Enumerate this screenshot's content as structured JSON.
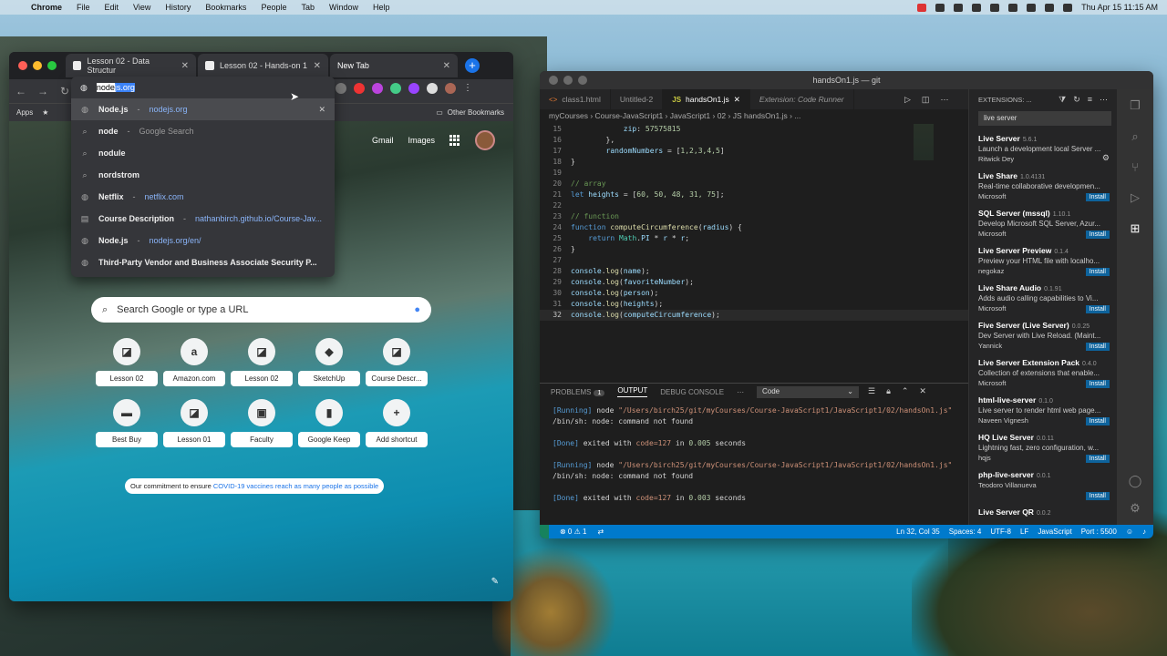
{
  "menubar": {
    "app": "Chrome",
    "items": [
      "File",
      "Edit",
      "View",
      "History",
      "Bookmarks",
      "People",
      "Tab",
      "Window",
      "Help"
    ],
    "clock": "Thu Apr 15  11:15 AM"
  },
  "chrome": {
    "tabs": [
      {
        "label": "Lesson 02 - Data Structur"
      },
      {
        "label": "Lesson 02 - Hands-on 1"
      },
      {
        "label": "New Tab"
      }
    ],
    "bookmarks": {
      "apps": "Apps",
      "other": "Other Bookmarks"
    },
    "omnibox": {
      "typed": "node",
      "autocomplete": "js.org",
      "suggestions": [
        {
          "main": "Node.js",
          "sep": " - ",
          "url": "nodejs.org",
          "icon": "globe-icon"
        },
        {
          "main": "node",
          "sep": " - ",
          "url": "Google Search",
          "icon": "search-icon",
          "gs": true
        },
        {
          "main": "nodule",
          "sep": "",
          "url": "",
          "icon": "search-icon"
        },
        {
          "main": "nordstrom",
          "sep": "",
          "url": "",
          "icon": "search-icon"
        },
        {
          "main": "Netflix",
          "sep": " - ",
          "url": "netflix.com",
          "icon": "globe-icon"
        },
        {
          "main": "Course Description",
          "sep": " - ",
          "url": "nathanbirch.github.io/Course-Jav...",
          "icon": "bookmark-icon"
        },
        {
          "main": "Node.js",
          "sep": " - ",
          "url": "nodejs.org/en/",
          "icon": "globe-icon"
        },
        {
          "main": "Third-Party Vendor and Business Associate Security P...",
          "sep": "",
          "url": "",
          "icon": "globe-icon"
        }
      ]
    },
    "newtab": {
      "gmail": "Gmail",
      "images": "Images",
      "search_placeholder": "Search Google or type a URL",
      "shortcuts": [
        {
          "label": "Lesson 02",
          "glyph": "◪"
        },
        {
          "label": "Amazon.com",
          "glyph": "a"
        },
        {
          "label": "Lesson 02",
          "glyph": "◪"
        },
        {
          "label": "SketchUp",
          "glyph": "◆"
        },
        {
          "label": "Course Descr...",
          "glyph": "◪"
        },
        {
          "label": "Best Buy",
          "glyph": "▬"
        },
        {
          "label": "Lesson 01",
          "glyph": "◪"
        },
        {
          "label": "Faculty",
          "glyph": "▣"
        },
        {
          "label": "Google Keep",
          "glyph": "▮"
        },
        {
          "label": "Add shortcut",
          "glyph": "+"
        }
      ],
      "covid_prefix": "Our commitment to ensure ",
      "covid_link": "COVID-19 vaccines reach as many people as possible"
    }
  },
  "vscode": {
    "title": "handsOn1.js — git",
    "tabs": [
      {
        "label": "class1.html",
        "icon": "<>"
      },
      {
        "label": "Untitled-2",
        "icon": ""
      },
      {
        "label": "handsOn1.js",
        "icon": "JS"
      },
      {
        "label": "Extension: Code Runner",
        "icon": ""
      }
    ],
    "breadcrumbs": "myCourses  ›  Course-JavaScript1  ›  JavaScript1  ›  02  ›  JS handsOn1.js  ›  ...",
    "code": [
      {
        "n": "15",
        "html": "            <span class='var'>zip</span><span class='pl'>: </span><span class='num'>57575815</span>"
      },
      {
        "n": "16",
        "html": "        <span class='pl'>},</span>"
      },
      {
        "n": "17",
        "html": "        <span class='var'>randomNumbers</span><span class='pl'> = [</span><span class='num'>1,2,3,4,5</span><span class='pl'>]</span>"
      },
      {
        "n": "18",
        "html": "<span class='pl'>}</span>"
      },
      {
        "n": "19",
        "html": ""
      },
      {
        "n": "20",
        "html": "<span class='cm'>// array</span>"
      },
      {
        "n": "21",
        "html": "<span class='kw'>let</span> <span class='var'>heights</span><span class='pl'> = [</span><span class='num'>60, 50, 48, 31, 75</span><span class='pl'>];</span>"
      },
      {
        "n": "22",
        "html": ""
      },
      {
        "n": "23",
        "html": "<span class='cm'>// function</span>"
      },
      {
        "n": "24",
        "html": "<span class='kw'>function</span> <span class='fn'>computeCircumference</span><span class='pl'>(</span><span class='var'>radius</span><span class='pl'>) {</span>"
      },
      {
        "n": "25",
        "html": "    <span class='kw'>return</span> <span class='cls'>Math</span><span class='pl'>.</span><span class='var'>PI</span><span class='pl'> * </span><span class='var'>r</span><span class='pl'> * </span><span class='var'>r</span><span class='pl'>;</span>"
      },
      {
        "n": "26",
        "html": "<span class='pl'>}</span>"
      },
      {
        "n": "27",
        "html": ""
      },
      {
        "n": "28",
        "html": "<span class='var'>console</span><span class='pl'>.</span><span class='fn'>log</span><span class='pl'>(</span><span class='var'>name</span><span class='pl'>);</span>"
      },
      {
        "n": "29",
        "html": "<span class='var'>console</span><span class='pl'>.</span><span class='fn'>log</span><span class='pl'>(</span><span class='var'>favoriteNumber</span><span class='pl'>);</span>"
      },
      {
        "n": "30",
        "html": "<span class='var'>console</span><span class='pl'>.</span><span class='fn'>log</span><span class='pl'>(</span><span class='var'>person</span><span class='pl'>);</span>"
      },
      {
        "n": "31",
        "html": "<span class='var'>console</span><span class='pl'>.</span><span class='fn'>log</span><span class='pl'>(</span><span class='var'>heights</span><span class='pl'>);</span>"
      },
      {
        "n": "32",
        "html": "<span class='var'>console</span><span class='pl'>.</span><span class='fn'>log</span><span class='pl'>(</span><span class='var'>computeCircumference</span><span class='pl'>);</span>"
      }
    ],
    "panel": {
      "tabs": [
        "PROBLEMS",
        "OUTPUT",
        "DEBUG CONSOLE"
      ],
      "problems_count": "1",
      "channel": "Code",
      "output": [
        {
          "html": "<span class='o-running'>[Running]</span> <span class='o-txt'>node</span> <span class='o-path'>\"/Users/birch25/git/myCourses/Course-JavaScript1/JavaScript1/02/handsOn1.js\"</span>"
        },
        {
          "html": "<span class='o-txt'>/bin/sh: node: command not found</span>"
        },
        {
          "html": ""
        },
        {
          "html": "<span class='o-done'>[Done]</span> <span class='o-txt'>exited with</span> <span class='o-path'>code=127</span> <span class='o-txt'>in</span> <span class='o-num'>0.005</span> <span class='o-txt'>seconds</span>"
        },
        {
          "html": ""
        },
        {
          "html": "<span class='o-running'>[Running]</span> <span class='o-txt'>node</span> <span class='o-path'>\"/Users/birch25/git/myCourses/Course-JavaScript1/JavaScript1/02/handsOn1.js\"</span>"
        },
        {
          "html": "<span class='o-txt'>/bin/sh: node: command not found</span>"
        },
        {
          "html": ""
        },
        {
          "html": "<span class='o-done'>[Done]</span> <span class='o-txt'>exited with</span> <span class='o-path'>code=127</span> <span class='o-txt'>in</span> <span class='o-num'>0.003</span> <span class='o-txt'>seconds</span>"
        }
      ]
    },
    "extensions": {
      "header": "EXTENSIONS: ...",
      "search": "live server",
      "items": [
        {
          "name": "Live Server",
          "ver": "5.6.1",
          "desc": "Launch a development local Server ...",
          "pub": "Ritwick Dey",
          "installed": true
        },
        {
          "name": "Live Share",
          "ver": "1.0.4131",
          "desc": "Real-time collaborative developmen...",
          "pub": "Microsoft",
          "installed": false
        },
        {
          "name": "SQL Server (mssql)",
          "ver": "1.10.1",
          "desc": "Develop Microsoft SQL Server, Azur...",
          "pub": "Microsoft",
          "installed": false
        },
        {
          "name": "Live Server Preview",
          "ver": "0.1.4",
          "desc": "Preview your HTML file with localho...",
          "pub": "negokaz",
          "installed": false
        },
        {
          "name": "Live Share Audio",
          "ver": "0.1.91",
          "desc": "Adds audio calling capabilities to Vi...",
          "pub": "Microsoft",
          "installed": false
        },
        {
          "name": "Five Server (Live Server)",
          "ver": "0.0.25",
          "desc": "Dev Server with Live Reload. (Maint...",
          "pub": "Yannick",
          "installed": false
        },
        {
          "name": "Live Server Extension Pack",
          "ver": "0.4.0",
          "desc": "Collection of extensions that enable...",
          "pub": "Microsoft",
          "installed": false
        },
        {
          "name": "html-live-server",
          "ver": "0.1.0",
          "desc": "Live server to render html web page...",
          "pub": "Naveen Vignesh",
          "installed": false
        },
        {
          "name": "HQ Live Server",
          "ver": "0.0.11",
          "desc": "Lightning fast, zero configuration, w...",
          "pub": "hqjs",
          "installed": false
        },
        {
          "name": "php-live-server",
          "ver": "0.0.1",
          "desc": "",
          "pub": "Teodoro Villanueva",
          "installed": false
        },
        {
          "name": "Live Server QR",
          "ver": "0.0.2",
          "desc": "",
          "pub": "",
          "installed": false
        }
      ],
      "install_label": "Install"
    },
    "status": {
      "errors": "⊗ 0 ⚠ 1",
      "position": "Ln 32, Col 35",
      "spaces": "Spaces: 4",
      "encoding": "UTF-8",
      "eol": "LF",
      "lang": "JavaScript",
      "port": "Port : 5500"
    }
  }
}
